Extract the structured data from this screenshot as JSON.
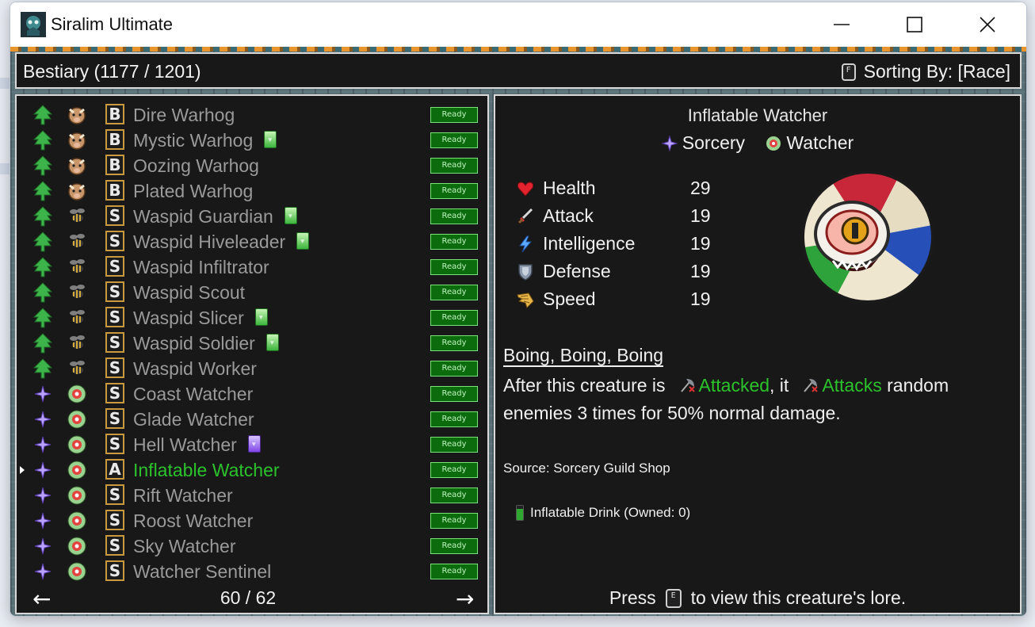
{
  "window": {
    "title": "Siralim Ultimate"
  },
  "header": {
    "title": "Bestiary (1177 / 1201)",
    "sort_key": "F",
    "sort_label": "Sorting By: [Race]"
  },
  "list": {
    "rows": [
      {
        "name": "Dire Warhog",
        "race_icon": "tree-icon",
        "family_icon": "warhog-icon",
        "rank": "B",
        "gem": "",
        "ready": "Ready"
      },
      {
        "name": "Mystic Warhog",
        "race_icon": "tree-icon",
        "family_icon": "warhog-icon",
        "rank": "B",
        "gem": "green",
        "ready": "Ready"
      },
      {
        "name": "Oozing Warhog",
        "race_icon": "tree-icon",
        "family_icon": "warhog-icon",
        "rank": "B",
        "gem": "",
        "ready": "Ready"
      },
      {
        "name": "Plated Warhog",
        "race_icon": "tree-icon",
        "family_icon": "warhog-icon",
        "rank": "B",
        "gem": "",
        "ready": "Ready"
      },
      {
        "name": "Waspid Guardian",
        "race_icon": "tree-icon",
        "family_icon": "waspid-icon",
        "rank": "S",
        "gem": "green",
        "ready": "Ready"
      },
      {
        "name": "Waspid Hiveleader",
        "race_icon": "tree-icon",
        "family_icon": "waspid-icon",
        "rank": "S",
        "gem": "green",
        "ready": "Ready"
      },
      {
        "name": "Waspid Infiltrator",
        "race_icon": "tree-icon",
        "family_icon": "waspid-icon",
        "rank": "S",
        "gem": "",
        "ready": "Ready"
      },
      {
        "name": "Waspid Scout",
        "race_icon": "tree-icon",
        "family_icon": "waspid-icon",
        "rank": "S",
        "gem": "",
        "ready": "Ready"
      },
      {
        "name": "Waspid Slicer",
        "race_icon": "tree-icon",
        "family_icon": "waspid-icon",
        "rank": "S",
        "gem": "green",
        "ready": "Ready"
      },
      {
        "name": "Waspid Soldier",
        "race_icon": "tree-icon",
        "family_icon": "waspid-icon",
        "rank": "S",
        "gem": "green",
        "ready": "Ready"
      },
      {
        "name": "Waspid Worker",
        "race_icon": "tree-icon",
        "family_icon": "waspid-icon",
        "rank": "S",
        "gem": "",
        "ready": "Ready"
      },
      {
        "name": "Coast Watcher",
        "race_icon": "sorcery-icon",
        "family_icon": "watcher-icon",
        "rank": "S",
        "gem": "",
        "ready": "Ready"
      },
      {
        "name": "Glade Watcher",
        "race_icon": "sorcery-icon",
        "family_icon": "watcher-icon",
        "rank": "S",
        "gem": "",
        "ready": "Ready"
      },
      {
        "name": "Hell Watcher",
        "race_icon": "sorcery-icon",
        "family_icon": "watcher-icon",
        "rank": "S",
        "gem": "purple",
        "ready": "Ready"
      },
      {
        "name": "Inflatable Watcher",
        "race_icon": "sorcery-icon",
        "family_icon": "watcher-icon",
        "rank": "A",
        "gem": "",
        "ready": "Ready",
        "selected": true
      },
      {
        "name": "Rift Watcher",
        "race_icon": "sorcery-icon",
        "family_icon": "watcher-icon",
        "rank": "S",
        "gem": "",
        "ready": "Ready"
      },
      {
        "name": "Roost Watcher",
        "race_icon": "sorcery-icon",
        "family_icon": "watcher-icon",
        "rank": "S",
        "gem": "",
        "ready": "Ready"
      },
      {
        "name": "Sky Watcher",
        "race_icon": "sorcery-icon",
        "family_icon": "watcher-icon",
        "rank": "S",
        "gem": "",
        "ready": "Ready"
      },
      {
        "name": "Watcher Sentinel",
        "race_icon": "sorcery-icon",
        "family_icon": "watcher-icon",
        "rank": "S",
        "gem": "",
        "ready": "Ready"
      }
    ],
    "page": "60 / 62",
    "prev_icon": "arrow-left-icon",
    "next_icon": "arrow-right-icon"
  },
  "detail": {
    "name": "Inflatable Watcher",
    "class_label": "Sorcery",
    "family_label": "Watcher",
    "stats": [
      {
        "name": "Health",
        "value": "29",
        "icon": "heart-icon"
      },
      {
        "name": "Attack",
        "value": "19",
        "icon": "sword-icon"
      },
      {
        "name": "Intelligence",
        "value": "19",
        "icon": "lightning-icon"
      },
      {
        "name": "Defense",
        "value": "19",
        "icon": "shield-icon"
      },
      {
        "name": "Speed",
        "value": "19",
        "icon": "wing-icon"
      }
    ],
    "trait_name": "Boing, Boing, Boing",
    "trait_pre": "After this creature is",
    "trait_kw1": "Attacked",
    "trait_mid": ", it",
    "trait_kw2": "Attacks",
    "trait_post": "random enemies 3 times for 50% normal damage.",
    "source": "Source: Sorcery Guild Shop",
    "drink": "Inflatable Drink (Owned: 0)",
    "press_pre": "Press",
    "press_key": "E",
    "press_post": "to view this creature's lore."
  },
  "colors": {
    "selected": "#2cc22c",
    "keyword": "#2cc22c",
    "ready_bg": "#0c6b0c"
  }
}
